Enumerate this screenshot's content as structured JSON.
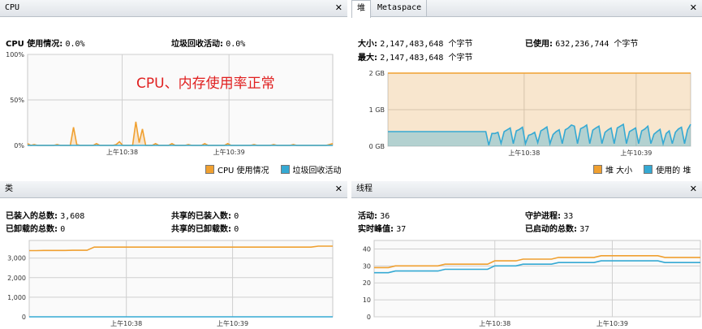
{
  "colors": {
    "orange": "#f0a030",
    "blue": "#35a9d3",
    "grid": "#cfcfcf",
    "plot_bg": "#fafafa"
  },
  "cpu": {
    "tab": "CPU",
    "close": "✕",
    "usage_label": "CPU 使用情况:",
    "usage_value": "0.0%",
    "gc_label": "垃圾回收活动:",
    "gc_value": "0.0%",
    "annotation": "CPU、内存使用率正常",
    "legend": [
      {
        "label": "CPU 使用情况",
        "color": "#f0a030"
      },
      {
        "label": "垃圾回收活动",
        "color": "#35a9d3"
      }
    ]
  },
  "heap": {
    "tab_active": "堆",
    "tab_inactive": "Metaspace",
    "close": "✕",
    "size_label": "大小:",
    "size_value": "2,147,483,648 个字节",
    "used_label": "已使用:",
    "used_value": "632,236,744 个字节",
    "max_label": "最大:",
    "max_value": "2,147,483,648 个字节",
    "legend": [
      {
        "label": "堆 大小",
        "color": "#f0a030"
      },
      {
        "label": "使用的 堆",
        "color": "#35a9d3"
      }
    ]
  },
  "classes": {
    "tab": "类",
    "close": "✕",
    "loaded_label": "已装入的总数:",
    "loaded_value": "3,608",
    "unloaded_label": "已卸载的总数:",
    "unloaded_value": "0",
    "shared_loaded_label": "共享的已装入数:",
    "shared_loaded_value": "0",
    "shared_unloaded_label": "共享的已卸载数:",
    "shared_unloaded_value": "0"
  },
  "threads": {
    "tab": "线程",
    "close": "✕",
    "live_label": "活动:",
    "live_value": "36",
    "daemon_label": "守护进程:",
    "daemon_value": "33",
    "peak_label": "实时峰值:",
    "peak_value": "37",
    "started_label": "已启动的总数:",
    "started_value": "37"
  },
  "chart_data": [
    {
      "type": "area",
      "name": "cpu",
      "x_ticks": [
        "上午10:38",
        "上午10:39"
      ],
      "y_ticks": [
        "100%",
        "50%",
        "0%"
      ],
      "ylim": [
        0,
        100
      ],
      "series": [
        {
          "name": "CPU 使用情况",
          "values": [
            2,
            0,
            1,
            0,
            0,
            0,
            0,
            0,
            0,
            1,
            0,
            0,
            0,
            0,
            20,
            1,
            0,
            0,
            0,
            0,
            0,
            2,
            0,
            0,
            0,
            0,
            0,
            1,
            4,
            0,
            0,
            0,
            0,
            26,
            3,
            18,
            0,
            0,
            0,
            2,
            0,
            0,
            0,
            0,
            2,
            0,
            0,
            0,
            0,
            1,
            0,
            0,
            0,
            0,
            2,
            0,
            0,
            0,
            0,
            0,
            0,
            2,
            0,
            0,
            0,
            0,
            0,
            0,
            0,
            1,
            0,
            0,
            0,
            0,
            0,
            1,
            0,
            0,
            0,
            0,
            0,
            1,
            0,
            0,
            0,
            0,
            0,
            0,
            0,
            0,
            0,
            0,
            1,
            2
          ]
        },
        {
          "name": "垃圾回收活动",
          "values": [
            0,
            0,
            0,
            0,
            0,
            0,
            0,
            0,
            0,
            0,
            0,
            0,
            0,
            0,
            0,
            0,
            0,
            0,
            0,
            0,
            0,
            0,
            0,
            0,
            0,
            0,
            0,
            0,
            0,
            0,
            0,
            0,
            0,
            0,
            0,
            0,
            0,
            0,
            0,
            0,
            0,
            0,
            0,
            0,
            0,
            0,
            0,
            0,
            0,
            0,
            0,
            0,
            0,
            0,
            0,
            0,
            0,
            0,
            0,
            0,
            0,
            0,
            0,
            0,
            0,
            0,
            0,
            0,
            0,
            0,
            0,
            0,
            0,
            0,
            0,
            0,
            0,
            0,
            0,
            0,
            0,
            0,
            0,
            0,
            0,
            0,
            0,
            0,
            0,
            0,
            0,
            0,
            0,
            0
          ]
        }
      ]
    },
    {
      "type": "area",
      "name": "heap",
      "x_ticks": [
        "上午10:38",
        "上午10:39"
      ],
      "y_ticks": [
        "2 GB",
        "1 GB",
        "0 GB"
      ],
      "ylim": [
        0,
        2
      ],
      "series": [
        {
          "name": "堆 大小",
          "values": [
            2,
            2,
            2,
            2,
            2,
            2,
            2,
            2,
            2,
            2,
            2,
            2,
            2,
            2,
            2,
            2,
            2,
            2,
            2,
            2,
            2,
            2,
            2,
            2,
            2,
            2,
            2,
            2,
            2,
            2,
            2,
            2,
            2,
            2,
            2,
            2,
            2,
            2,
            2,
            2,
            2,
            2,
            2,
            2,
            2,
            2,
            2,
            2,
            2,
            2,
            2,
            2,
            2,
            2,
            2,
            2,
            2,
            2,
            2,
            2,
            2,
            2,
            2,
            2,
            2,
            2,
            2,
            2,
            2,
            2,
            2,
            2,
            2,
            2,
            2,
            2,
            2,
            2,
            2,
            2,
            2,
            2,
            2,
            2,
            2,
            2,
            2,
            2,
            2,
            2,
            2,
            2,
            2,
            2,
            2,
            2,
            2,
            2,
            2,
            2
          ]
        },
        {
          "name": "使用的 堆",
          "values": [
            0.4,
            0.4,
            0.4,
            0.4,
            0.4,
            0.4,
            0.4,
            0.4,
            0.4,
            0.4,
            0.4,
            0.4,
            0.4,
            0.4,
            0.4,
            0.4,
            0.4,
            0.4,
            0.4,
            0.4,
            0.4,
            0.4,
            0.4,
            0.4,
            0.4,
            0.4,
            0.4,
            0.4,
            0.4,
            0.4,
            0.4,
            0.4,
            0.4,
            0.03,
            0.35,
            0.35,
            0.38,
            0.08,
            0.4,
            0.45,
            0.5,
            0.07,
            0.42,
            0.46,
            0.52,
            0.07,
            0.3,
            0.33,
            0.38,
            0.1,
            0.42,
            0.47,
            0.53,
            0.07,
            0.32,
            0.4,
            0.45,
            0.07,
            0.45,
            0.5,
            0.58,
            0.55,
            0.07,
            0.48,
            0.52,
            0.58,
            0.07,
            0.44,
            0.5,
            0.55,
            0.07,
            0.38,
            0.45,
            0.5,
            0.07,
            0.5,
            0.55,
            0.6,
            0.07,
            0.4,
            0.45,
            0.5,
            0.07,
            0.42,
            0.47,
            0.55,
            0.07,
            0.33,
            0.4,
            0.46,
            0.07,
            0.35,
            0.42,
            0.07,
            0.38,
            0.47,
            0.52,
            0.07,
            0.45,
            0.6
          ]
        }
      ]
    },
    {
      "type": "line",
      "name": "classes",
      "x_ticks": [
        "上午10:38",
        "上午10:39"
      ],
      "y_ticks": [
        "3,000",
        "2,000",
        "1,000",
        "0"
      ],
      "ylim": [
        0,
        3900
      ],
      "series": [
        {
          "name": "已装入的总数",
          "values": [
            3380,
            3380,
            3390,
            3390,
            3390,
            3390,
            3400,
            3400,
            3400,
            3560,
            3560,
            3560,
            3560,
            3560,
            3560,
            3560,
            3560,
            3560,
            3560,
            3560,
            3560,
            3560,
            3560,
            3560,
            3560,
            3560,
            3560,
            3560,
            3560,
            3560,
            3560,
            3560,
            3560,
            3560,
            3560,
            3560,
            3560,
            3560,
            3560,
            3560,
            3608,
            3608,
            3608
          ]
        },
        {
          "name": "已卸载的总数",
          "values": [
            0,
            0,
            0,
            0,
            0,
            0,
            0,
            0,
            0,
            0,
            0,
            0,
            0,
            0,
            0,
            0,
            0,
            0,
            0,
            0,
            0,
            0,
            0,
            0,
            0,
            0,
            0,
            0,
            0,
            0,
            0,
            0,
            0,
            0,
            0,
            0,
            0,
            0,
            0,
            0,
            0,
            0,
            0
          ]
        }
      ]
    },
    {
      "type": "line",
      "name": "threads",
      "x_ticks": [
        "上午10:38",
        "上午10:39"
      ],
      "y_ticks": [
        "40",
        "30",
        "20",
        "10",
        "0"
      ],
      "ylim": [
        0,
        45
      ],
      "series": [
        {
          "name": "实时峰值",
          "values": [
            29,
            29,
            29,
            30,
            30,
            30,
            30,
            30,
            30,
            30,
            31,
            31,
            31,
            31,
            31,
            31,
            31,
            33,
            33,
            33,
            33,
            34,
            34,
            34,
            34,
            34,
            35,
            35,
            35,
            35,
            35,
            35,
            36,
            36,
            36,
            36,
            36,
            36,
            36,
            36,
            36,
            35,
            35,
            35,
            35,
            35,
            35
          ]
        },
        {
          "name": "活动",
          "values": [
            26,
            26,
            26,
            27,
            27,
            27,
            27,
            27,
            27,
            27,
            28,
            28,
            28,
            28,
            28,
            28,
            28,
            30,
            30,
            30,
            30,
            31,
            31,
            31,
            31,
            31,
            32,
            32,
            32,
            32,
            32,
            32,
            33,
            33,
            33,
            33,
            33,
            33,
            33,
            33,
            33,
            32,
            32,
            32,
            32,
            32,
            32
          ]
        }
      ]
    }
  ]
}
